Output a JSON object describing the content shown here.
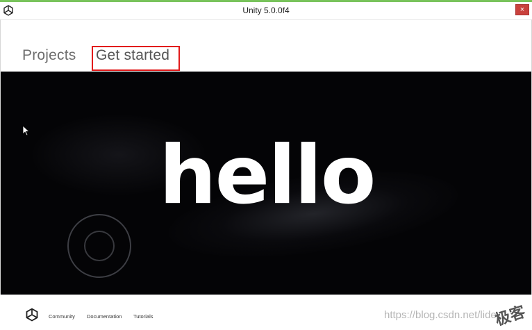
{
  "window": {
    "title": "Unity 5.0.0f4",
    "close_label": "×",
    "app_icon": "unity-logo-icon"
  },
  "tabs": [
    {
      "label": "Projects",
      "active": false
    },
    {
      "label": "Get started",
      "active": true,
      "highlighted": true
    }
  ],
  "video": {
    "overlay_text": "hello"
  },
  "footer": {
    "links": [
      "Community",
      "Documentation",
      "Tutorials"
    ],
    "watermark": "https://blog.csdn.net/lide",
    "watermark_mark": "极客"
  },
  "colors": {
    "highlight_border": "#e21b1b",
    "video_background": "#040406",
    "close_button": "#c9413c"
  }
}
